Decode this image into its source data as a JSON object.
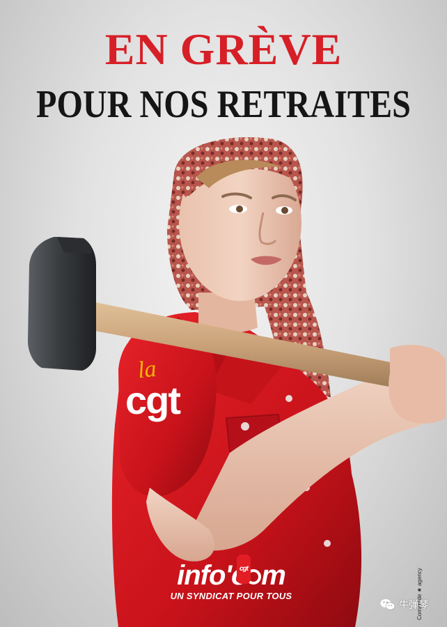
{
  "headline": {
    "line1": "EN GRÈVE",
    "line2": "POUR NOS RETRAITES"
  },
  "sleeve_logo": {
    "la": "la",
    "cgt": "cgt"
  },
  "footer_logo": {
    "info_word": "info'c",
    "info_end": "m",
    "badge": "cgt",
    "tagline": "UN SYNDICAT POUR TOUS"
  },
  "credit": "Comarade ★ agency",
  "watermark": {
    "text": "牛弹琴",
    "icon": "wechat-icon"
  },
  "colors": {
    "headline_red": "#d61f26",
    "headline_black": "#151515",
    "shirt_red": "#d4141b",
    "logo_yellow": "#f3b500",
    "background": "#e2e2e2"
  }
}
